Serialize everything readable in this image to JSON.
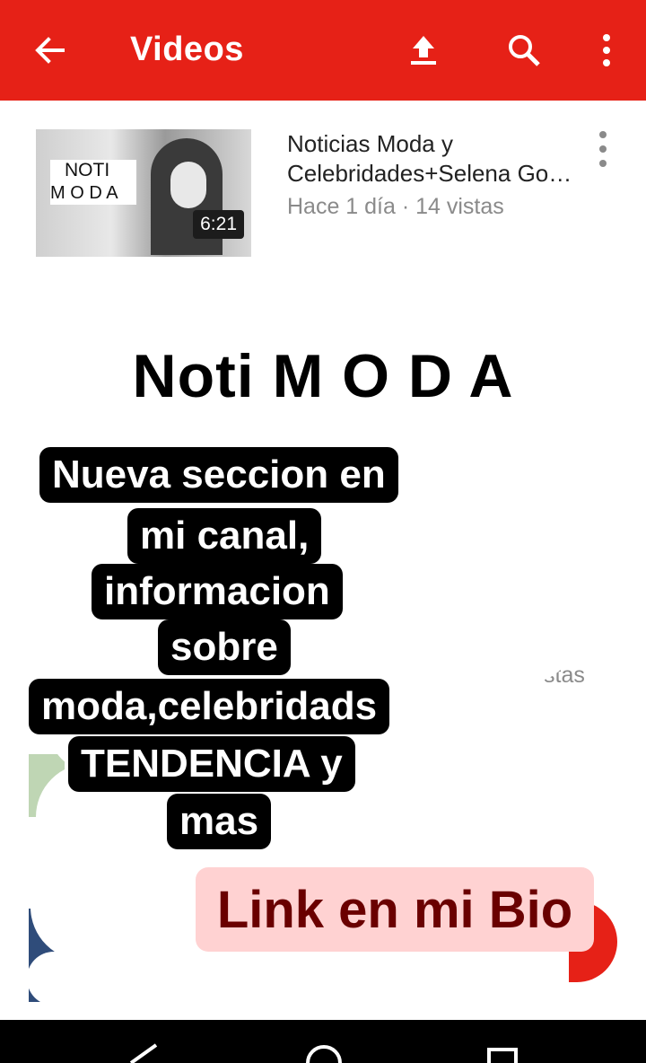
{
  "app_bar": {
    "title": "Videos",
    "back_icon": "arrow-left-icon",
    "upload_icon": "upload-icon",
    "search_icon": "search-icon",
    "more_icon": "more-vert-icon"
  },
  "videos": [
    {
      "thumb_line1": "NOTI",
      "thumb_line2": "M O D A",
      "duration": "6:21",
      "title_line1": "Noticias Moda y",
      "title_line2": "Celebridades+Selena Go…",
      "meta": "Hace 1 día · 14 vistas"
    }
  ],
  "partial_meta": "stas",
  "overlay": {
    "headline": "Noti M O D A",
    "lines": [
      "Nueva seccion en",
      "mi canal,",
      "informacion",
      "sobre",
      "moda,celebridads",
      "TENDENCIA y",
      "mas"
    ],
    "link": "Link en mi Bio"
  },
  "colors": {
    "accent": "#e62117",
    "link_bg": "#ffd2d2",
    "link_text": "#6a0000"
  }
}
